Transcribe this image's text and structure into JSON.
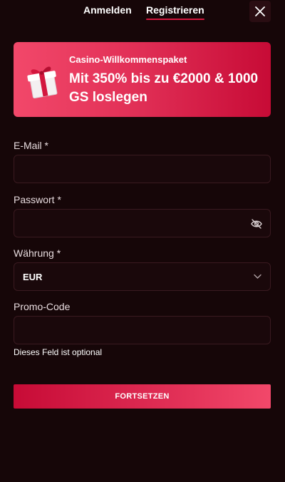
{
  "tabs": {
    "login_label": "Anmelden",
    "register_label": "Registrieren",
    "active": "register"
  },
  "banner": {
    "kicker": "Casino-Willkommenspaket",
    "title": "Mit 350% bis zu €2000 & 1000 GS loslegen",
    "icon": "gift-icon"
  },
  "form": {
    "email": {
      "label": "E-Mail *",
      "value": "",
      "placeholder": ""
    },
    "password": {
      "label": "Passwort *",
      "value": "",
      "placeholder": ""
    },
    "currency": {
      "label": "Währung *",
      "selected": "EUR"
    },
    "promo": {
      "label": "Promo-Code",
      "value": "",
      "placeholder": "",
      "helper": "Dieses Feld ist optional"
    },
    "submit_label": "FORTSETZEN"
  },
  "colors": {
    "background": "#160608",
    "accent": "#d3173e",
    "field_border": "#3a1a20"
  }
}
